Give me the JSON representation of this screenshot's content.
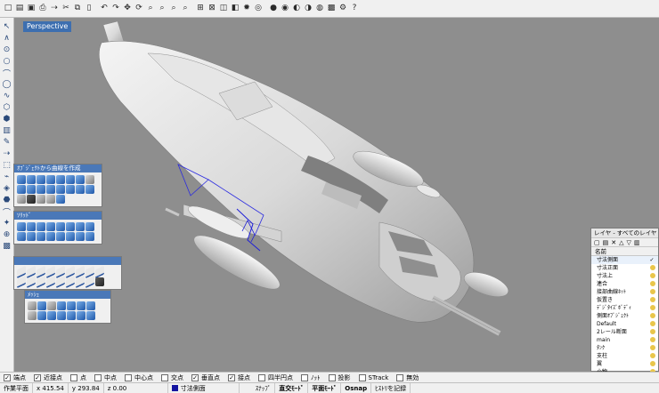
{
  "top_toolbar": {
    "icons": [
      "new-file",
      "open-file",
      "save",
      "print",
      "import",
      "cut",
      "copy",
      "paste",
      "undo",
      "redo",
      "pan",
      "rotate-view",
      "zoom-dynamic",
      "zoom-window",
      "zoom-extents",
      "zoom-selected",
      "four-viewports",
      "grid",
      "layers",
      "object-properties",
      "lights",
      "render-settings",
      "shade",
      "rendered",
      "ghosted",
      "x-ray",
      "render",
      "preview",
      "rhino-options",
      "help"
    ],
    "glyphs": [
      "□",
      "▤",
      "▣",
      "⎙",
      "⇢",
      "✂",
      "⧉",
      "▯",
      "↶",
      "↷",
      "✥",
      "⟳",
      "⌕",
      "⌕",
      "⌕",
      "⌕",
      "⊞",
      "⊠",
      "◫",
      "◧",
      "✹",
      "◎",
      "●",
      "◉",
      "◐",
      "◑",
      "◍",
      "▩",
      "⚙",
      "?"
    ]
  },
  "left_toolbar": {
    "glyphs": [
      "↖",
      "∧",
      "⊙",
      "○",
      "⌒",
      "◯",
      "∿",
      "⬡",
      "⬢",
      "▥",
      "✎",
      "⇢",
      "⬚",
      "⌁",
      "◈",
      "⬣",
      "⌒",
      "✦",
      "⊕",
      "▩"
    ]
  },
  "viewport": {
    "label": "Perspective"
  },
  "palettes": [
    {
      "title": "ｵﾌﾞｼﾞｪｸﾄから曲線を作成",
      "cols": 8,
      "tiles": [
        "blue",
        "blue",
        "blue",
        "blue",
        "blue",
        "blue",
        "blue",
        "gray",
        "blue",
        "blue",
        "blue",
        "blue",
        "blue",
        "blue",
        "blue",
        "blue",
        "gray",
        "dark",
        "gray",
        "gray",
        "blue"
      ]
    },
    {
      "title": "ｿﾘｯﾄﾞ",
      "cols": 8,
      "tiles": [
        "blue",
        "blue",
        "blue",
        "blue",
        "blue",
        "blue",
        "blue",
        "blue",
        "blue",
        "blue",
        "blue",
        "blue",
        "blue",
        "blue",
        "blue",
        "blue"
      ]
    },
    {
      "title": "",
      "cols": 9,
      "tiles": [
        "line",
        "line",
        "line",
        "line",
        "line",
        "line",
        "line",
        "line",
        "line",
        "line",
        "line",
        "line",
        "line",
        "line",
        "line",
        "line",
        "line",
        "dark"
      ]
    },
    {
      "title": "ﾒｯｼｭ",
      "cols": 7,
      "tiles": [
        "gray",
        "blue",
        "gray",
        "blue",
        "blue",
        "blue",
        "blue",
        "gray",
        "blue",
        "blue",
        "blue",
        "blue",
        "blue",
        "blue"
      ]
    }
  ],
  "layers": {
    "title": "レイヤ - すべてのレイヤ",
    "tool_glyphs": [
      "▢",
      "▤",
      "✕",
      "△",
      "▽",
      "▥"
    ],
    "column_name": "名前",
    "current_mark": "✓",
    "items": [
      {
        "name": "寸法側面",
        "current": true
      },
      {
        "name": "寸法正面"
      },
      {
        "name": "寸法上"
      },
      {
        "name": "連合"
      },
      {
        "name": "接部曲線ﾈｯﾄ"
      },
      {
        "name": "仮置き"
      },
      {
        "name": "ﾃﾞｼﾞﾀｲｽﾞﾎﾞﾃﾞｨ"
      },
      {
        "name": "側面ｵﾌﾞｼﾞｪｸﾄ"
      },
      {
        "name": "Default"
      },
      {
        "name": "2レール断面"
      },
      {
        "name": "main"
      },
      {
        "name": "ﾀﾝｸ"
      },
      {
        "name": "支柱"
      },
      {
        "name": "翼"
      },
      {
        "name": "小物"
      },
      {
        "name": "作業2"
      },
      {
        "name": "ﾌﾛﾝﾄ",
        "selected": true
      }
    ]
  },
  "osnap": [
    {
      "label": "端点",
      "checked": true
    },
    {
      "label": "近接点",
      "checked": true
    },
    {
      "label": "点",
      "checked": false
    },
    {
      "label": "中点",
      "checked": false
    },
    {
      "label": "中心点",
      "checked": false
    },
    {
      "label": "交点",
      "checked": false
    },
    {
      "label": "垂直点",
      "checked": true
    },
    {
      "label": "接点",
      "checked": true
    },
    {
      "label": "四半円点",
      "checked": false
    },
    {
      "label": "ﾉｯﾄ",
      "checked": false
    },
    {
      "label": "投影",
      "checked": false
    },
    {
      "label": "STrack",
      "checked": false
    },
    {
      "label": "無効",
      "checked": false
    }
  ],
  "status": {
    "cplane": "作業平面",
    "x": "x 415.54",
    "y": "y 293.84",
    "z": "z 0.00",
    "layer": "寸法側面",
    "layer_color": "#1414a0",
    "snap": "ｽﾅｯﾌﾟ",
    "ortho": "直交ﾓｰﾄﾞ",
    "planar": "平面ﾓｰﾄﾞ",
    "osnap": "Osnap",
    "history": "ﾋｽﾄﾘを記録"
  }
}
